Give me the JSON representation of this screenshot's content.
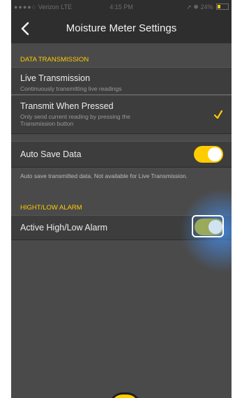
{
  "status_bar": {
    "carrier": "Verizon",
    "network": "LTE",
    "time": "4:15 PM",
    "battery": "24%"
  },
  "nav": {
    "title": "Moisture Meter Settings",
    "back_icon": "chevron-left-icon"
  },
  "sections": {
    "data_transmission": {
      "header": "DATA TRANSMISSION",
      "live": {
        "title": "Live Transmission",
        "subtitle": "Continuously transmitting live readings",
        "selected": false
      },
      "when_pressed": {
        "title": "Transmit When Pressed",
        "subtitle": "Only send current reading by pressing the Transmission button",
        "selected": true,
        "check_icon": "checkmark-icon"
      }
    },
    "auto_save": {
      "title": "Auto Save Data",
      "enabled": true,
      "note": "Auto save transmitted data. Not available for Live Transmission."
    },
    "alarm": {
      "header": "HIGHT/LOW ALARM",
      "title": "Active High/Low Alarm",
      "enabled": true
    }
  },
  "colors": {
    "accent": "#ffcc00",
    "background": "#4a4a4a",
    "bar": "#2e2e2e",
    "alarm_toggle": "#9aaa5a",
    "focus_glow": "#468ce6"
  }
}
